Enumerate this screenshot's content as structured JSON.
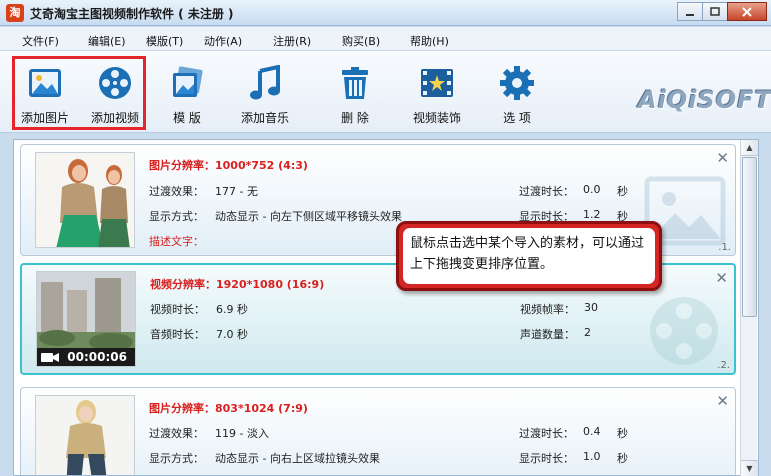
{
  "window": {
    "icon_text": "淘",
    "title": "艾奇淘宝主图视频制作软件 ( 未注册 )"
  },
  "menu": [
    "文件(F)",
    "编辑(E)",
    "模版(T)",
    "动作(A)",
    "注册(R)",
    "购买(B)",
    "帮助(H)"
  ],
  "toolbar": {
    "items": [
      {
        "label": "添加图片",
        "icon": "add-image-icon"
      },
      {
        "label": "添加视频",
        "icon": "add-video-icon"
      },
      {
        "label": "模  版",
        "icon": "template-icon"
      },
      {
        "label": "添加音乐",
        "icon": "music-icon"
      },
      {
        "label": "删  除",
        "icon": "trash-icon"
      },
      {
        "label": "视频装饰",
        "icon": "video-decoration-icon"
      },
      {
        "label": "选  项",
        "icon": "gear-icon"
      }
    ],
    "brand": "AiQiSOFT"
  },
  "cards": [
    {
      "type": "image",
      "header": "图片分辨率：1000*752 (4:3)",
      "rows_left": [
        {
          "label": "过渡效果：",
          "value": "177 -  无"
        },
        {
          "label": "显示方式：",
          "value": "动态显示 - 向左下侧区域平移镜头效果"
        }
      ],
      "rows_right": [
        {
          "label": "过渡时长：",
          "value": "0.0",
          "unit": "秒"
        },
        {
          "label": "显示时长：",
          "value": "1.2",
          "unit": "秒"
        }
      ],
      "desc_label": "描述文字：",
      "index": ".1.",
      "close": "✕"
    },
    {
      "type": "video",
      "header": "视频分辨率：1920*1080 (16:9)",
      "rows_left": [
        {
          "label": "视频时长：",
          "value": "6.9 秒"
        },
        {
          "label": "音频时长：",
          "value": "7.0 秒"
        }
      ],
      "rows_right": [
        {
          "label": "视频帧率：",
          "value": "30"
        },
        {
          "label": "声道数量：",
          "value": "2"
        }
      ],
      "duration": "00:00:06",
      "index": ".2.",
      "close": "✕"
    },
    {
      "type": "image",
      "header": "图片分辨率：803*1024 (7:9)",
      "rows_left": [
        {
          "label": "过渡效果：",
          "value": "119 -  淡入"
        },
        {
          "label": "显示方式：",
          "value": "动态显示 - 向右上区域拉镜头效果"
        }
      ],
      "rows_right": [
        {
          "label": "过渡时长：",
          "value": "0.4",
          "unit": "秒"
        },
        {
          "label": "显示时长：",
          "value": "1.0",
          "unit": "秒"
        }
      ],
      "close": "✕"
    }
  ],
  "callout": "鼠标点击选中某个导入的素材，可以通过上下拖拽变更排序位置。",
  "colors": {
    "highlight": "#e3262a",
    "accent_red": "#d9201e",
    "selected_border": "#3cc2cf"
  }
}
